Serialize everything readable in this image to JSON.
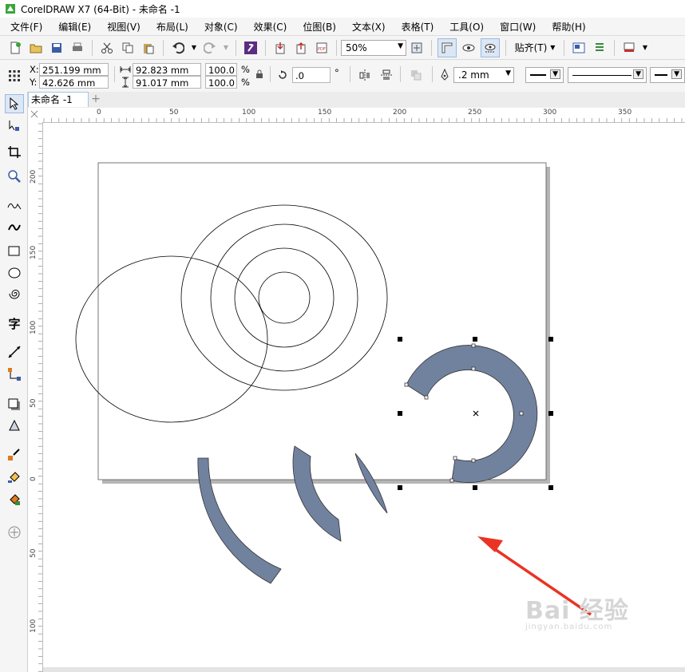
{
  "window": {
    "title": "CorelDRAW X7 (64-Bit) - 未命名 -1"
  },
  "menu": [
    "文件(F)",
    "编辑(E)",
    "视图(V)",
    "布局(L)",
    "对象(C)",
    "效果(C)",
    "位图(B)",
    "文本(X)",
    "表格(T)",
    "工具(O)",
    "窗口(W)",
    "帮助(H)"
  ],
  "toolbar": {
    "zoom": "50%",
    "snap_label": "贴齐(T)"
  },
  "propbar": {
    "x_label": "X:",
    "x_value": "251.199 mm",
    "y_label": "Y:",
    "y_value": "42.626 mm",
    "w_value": "92.823 mm",
    "h_value": "91.017 mm",
    "scale_w": "100.0",
    "scale_h": "100.0",
    "percent": "%",
    "rotation": ".0",
    "degree": "°",
    "outline_width": ".2 mm"
  },
  "doc_tab": {
    "label": "未命名 -1",
    "add": "+"
  },
  "ruler": {
    "h_ticks": [
      "0",
      "50",
      "100",
      "150",
      "200",
      "250",
      "300",
      "350"
    ],
    "v_ticks": [
      "200",
      "150",
      "100",
      "50",
      "0",
      "50",
      "100"
    ]
  },
  "watermark": {
    "main": "Bai 经验",
    "sub": "jingyan.baidu.com"
  },
  "colors": {
    "shape_fill": "#71829f",
    "arrow": "#ea3323",
    "selection": "#000000"
  }
}
